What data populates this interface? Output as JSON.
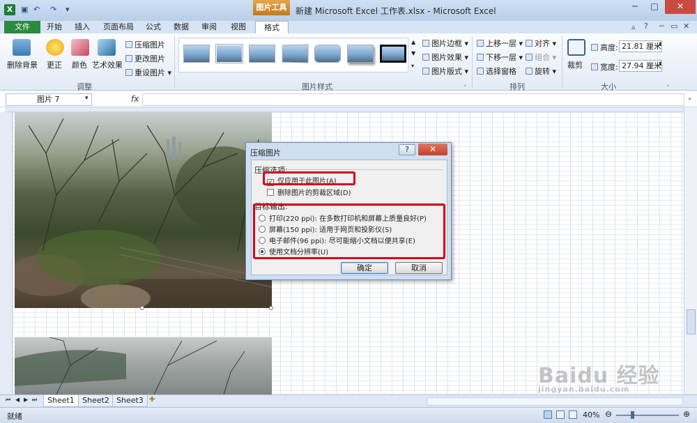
{
  "window": {
    "context_tab_title": "图片工具",
    "title": "新建 Microsoft Excel 工作表.xlsx - Microsoft Excel",
    "minimize": "─",
    "maximize": "□",
    "close": "✕"
  },
  "tabs": [
    "文件",
    "开始",
    "插入",
    "页面布局",
    "公式",
    "数据",
    "审阅",
    "视图",
    "格式"
  ],
  "ribbon": {
    "adjust": {
      "group_label": "调整",
      "remove_background": "删除背景",
      "corrections": "更正",
      "color": "颜色",
      "artistic_effects": "艺术效果",
      "compress_pictures": "压缩图片",
      "change_picture": "更改图片",
      "reset_picture": "重设图片"
    },
    "picture_styles": {
      "group_label": "图片样式",
      "border": "图片边框",
      "effects": "图片效果",
      "layout": "图片版式"
    },
    "arrange": {
      "group_label": "排列",
      "bring_forward": "上移一层",
      "send_backward": "下移一层",
      "selection_pane": "选择窗格",
      "align": "对齐",
      "group": "组合",
      "rotate": "旋转"
    },
    "size": {
      "group_label": "大小",
      "crop": "裁剪",
      "height_label": "高度:",
      "height_value": "21.81 厘米",
      "width_label": "宽度:",
      "width_value": "27.94 厘米"
    }
  },
  "formula_bar": {
    "name_box": "图片 7",
    "fx": "fx",
    "value": ""
  },
  "dialog": {
    "title": "压缩图片",
    "help": "?",
    "close": "✕",
    "compress_options_label": "压缩选项:",
    "options": [
      {
        "label": "仅应用于此图片(A)",
        "checked": true
      },
      {
        "label": "删除图片的剪裁区域(D)",
        "checked": false
      }
    ],
    "target_output_label": "目标输出:",
    "targets": [
      {
        "label": "打印(220 ppi): 在多数打印机和屏幕上质量良好(P)",
        "selected": false
      },
      {
        "label": "屏幕(150 ppi): 适用于网页和投影仪(S)",
        "selected": false
      },
      {
        "label": "电子邮件(96 ppi): 尽可能缩小文档以便共享(E)",
        "selected": false
      },
      {
        "label": "使用文档分辨率(U)",
        "selected": true
      }
    ],
    "ok": "确定",
    "cancel": "取消",
    "highlight_color": "#d5001c"
  },
  "sheets": [
    "Sheet1",
    "Sheet2",
    "Sheet3"
  ],
  "statusbar": {
    "status": "就绪",
    "zoom": "40%"
  },
  "watermark": {
    "main": "Baidu 经验",
    "sub": "jingyan.baidu.com"
  }
}
